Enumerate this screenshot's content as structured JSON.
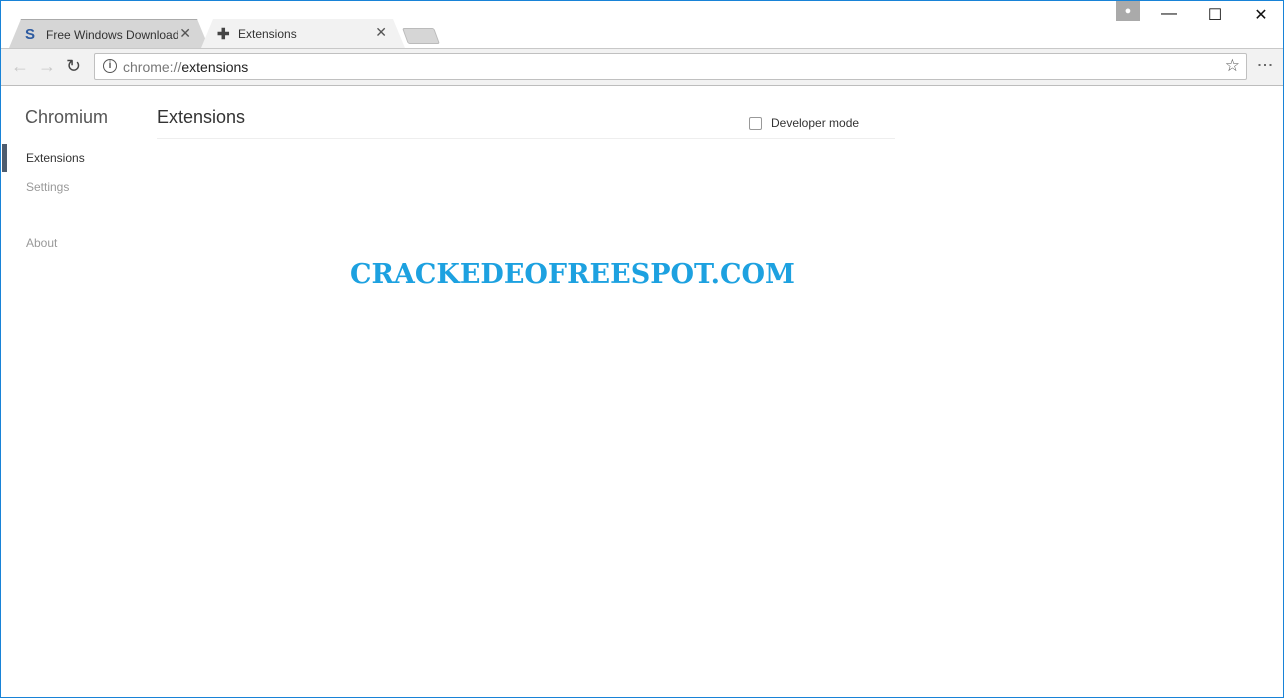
{
  "tabs": [
    {
      "title": "Free Windows Downloads",
      "icon": "S"
    },
    {
      "title": "Extensions",
      "icon": "puzzle-icon"
    }
  ],
  "window": {
    "minimize": "—",
    "maximize": "☐",
    "close": "✕"
  },
  "omnibox": {
    "scheme": "chrome://",
    "path": "extensions"
  },
  "sidebar": {
    "brand": "Chromium",
    "items": [
      {
        "label": "Extensions",
        "active": true
      },
      {
        "label": "Settings"
      },
      {
        "label": "About"
      }
    ]
  },
  "main": {
    "title": "Extensions",
    "developer_mode": "Developer mode",
    "developer_mode_checked": false
  },
  "watermark": "CRACKEDEOFREESPOT.COM",
  "colors": {
    "accent": "#1883d7",
    "watermark": "#1da1e0"
  }
}
